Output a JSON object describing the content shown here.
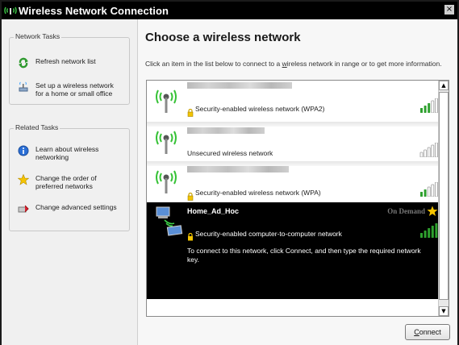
{
  "window": {
    "title": "Wireless Network Connection",
    "close_label": "×"
  },
  "sidebar": {
    "network_tasks": {
      "title": "Network Tasks",
      "items": [
        {
          "label": "Refresh network list",
          "icon": "refresh-icon"
        },
        {
          "label": "Set up a wireless network for a home or small office",
          "icon": "setup-network-icon"
        }
      ]
    },
    "related_tasks": {
      "title": "Related Tasks",
      "items": [
        {
          "label": "Learn about wireless networking",
          "icon": "info-icon"
        },
        {
          "label": "Change the order of preferred networks",
          "icon": "star-icon"
        },
        {
          "label": "Change advanced settings",
          "icon": "settings-icon"
        }
      ]
    }
  },
  "main": {
    "heading": "Choose a wireless network",
    "instruction_pre": "Click an item in the list below to connect to a ",
    "instruction_link": "w",
    "instruction_post": "ireless network in range or to get more information."
  },
  "networks": [
    {
      "name": "",
      "security": "Security-enabled wireless network (WPA2)",
      "signal_bars": 3,
      "secured": true
    },
    {
      "name": "",
      "security": "Unsecured wireless network",
      "signal_bars": 0,
      "secured": false
    },
    {
      "name": "",
      "security": "Security-enabled wireless network (WPA)",
      "signal_bars": 2,
      "secured": true
    },
    {
      "name": "Home_Ad_Hoc",
      "status": "On Demand",
      "security": "Security-enabled computer-to-computer network",
      "note": "To connect to this network, click Connect, and then type the required network key.",
      "signal_bars": 5,
      "secured": true,
      "selected": true
    }
  ],
  "buttons": {
    "connect_access_key": "C",
    "connect_rest": "onnect"
  },
  "colors": {
    "signal_green": "#2ea02e",
    "signal_empty": "#9a9a9a",
    "selected_bg": "#000000",
    "title_bar": "#000000",
    "star": "#f5c400"
  }
}
